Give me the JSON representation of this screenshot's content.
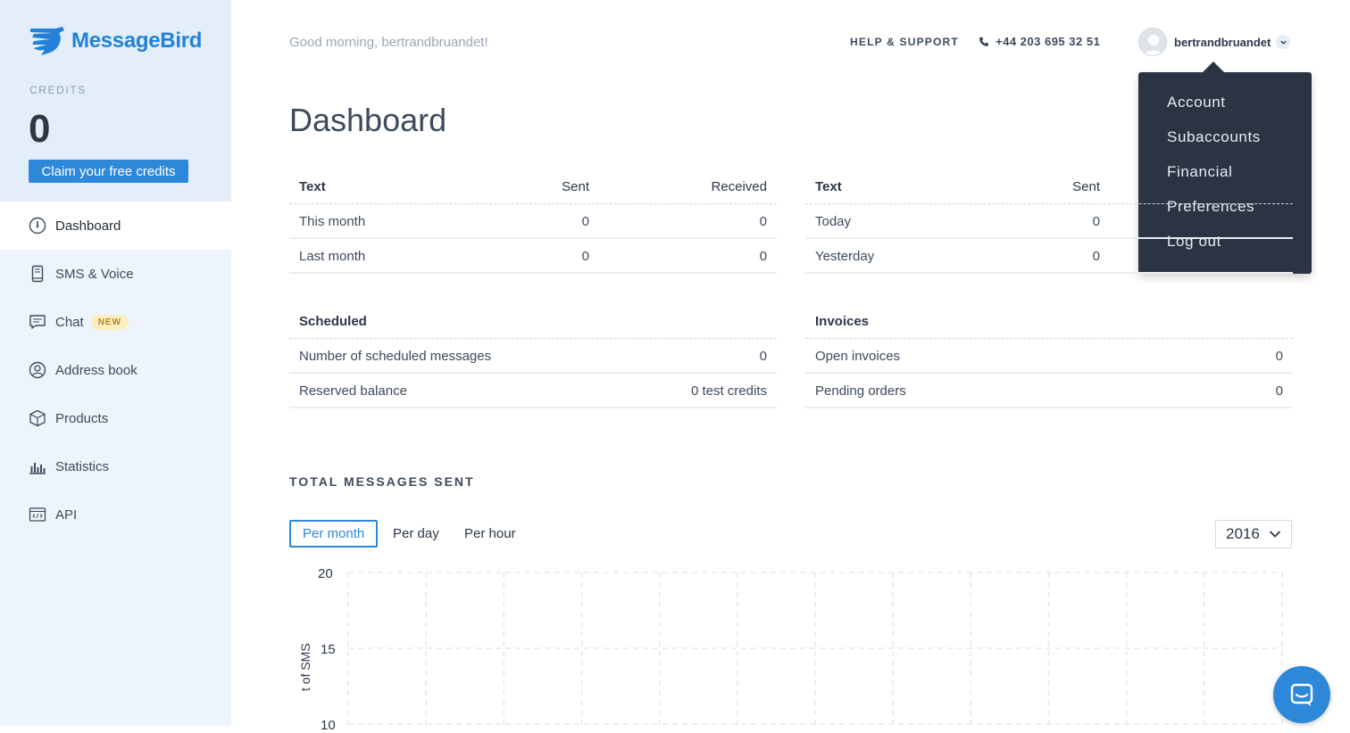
{
  "brand": {
    "name": "MessageBird",
    "color": "#2481d7"
  },
  "sidebar": {
    "credits_label": "CREDITS",
    "credits_value": "0",
    "claim_label": "Claim your free credits",
    "items": [
      {
        "label": "Dashboard",
        "icon": "dashboard-gauge-icon",
        "active": true
      },
      {
        "label": "SMS & Voice",
        "icon": "phone-device-icon"
      },
      {
        "label": "Chat",
        "icon": "chat-bubble-icon",
        "badge": "NEW"
      },
      {
        "label": "Address book",
        "icon": "contact-circle-icon"
      },
      {
        "label": "Products",
        "icon": "box-icon"
      },
      {
        "label": "Statistics",
        "icon": "bar-chart-icon"
      },
      {
        "label": "API",
        "icon": "code-window-icon"
      }
    ]
  },
  "header": {
    "greeting": "Good morning, bertrandbruandet!",
    "help": "HELP & SUPPORT",
    "phone": "+44 203 695 32 51",
    "username": "bertrandbruandet"
  },
  "user_dropdown": {
    "items": [
      "Account",
      "Subaccounts",
      "Financial",
      "Preferences",
      "Log out"
    ]
  },
  "main": {
    "title": "Dashboard",
    "table_monthly": {
      "headers": [
        "Text",
        "Sent",
        "Received"
      ],
      "rows": [
        [
          "This month",
          "0",
          "0"
        ],
        [
          "Last month",
          "0",
          "0"
        ]
      ]
    },
    "table_daily": {
      "headers": [
        "Text",
        "Sent"
      ],
      "rows": [
        [
          "Today",
          "0"
        ],
        [
          "Yesterday",
          "0"
        ]
      ]
    },
    "table_scheduled": {
      "header": "Scheduled",
      "rows": [
        [
          "Number of scheduled messages",
          "0"
        ],
        [
          "Reserved balance",
          "0 test credits"
        ]
      ]
    },
    "table_invoices": {
      "header": "Invoices",
      "rows": [
        [
          "Open invoices",
          "0"
        ],
        [
          "Pending orders",
          "0"
        ]
      ]
    },
    "section_title": "TOTAL MESSAGES SENT",
    "tabs": [
      "Per month",
      "Per day",
      "Per hour"
    ],
    "year": "2016"
  },
  "chart_data": {
    "type": "line",
    "y_ticks": [
      "20",
      "15",
      "10"
    ],
    "ylabel": "t of SMS",
    "ylim": [
      10,
      20
    ],
    "grid": true
  },
  "colors": {
    "accent": "#2d88da",
    "sidebar_bg": "#eef4fb",
    "dropdown_bg": "#2b3443",
    "badge_bg": "#fbeec1"
  }
}
